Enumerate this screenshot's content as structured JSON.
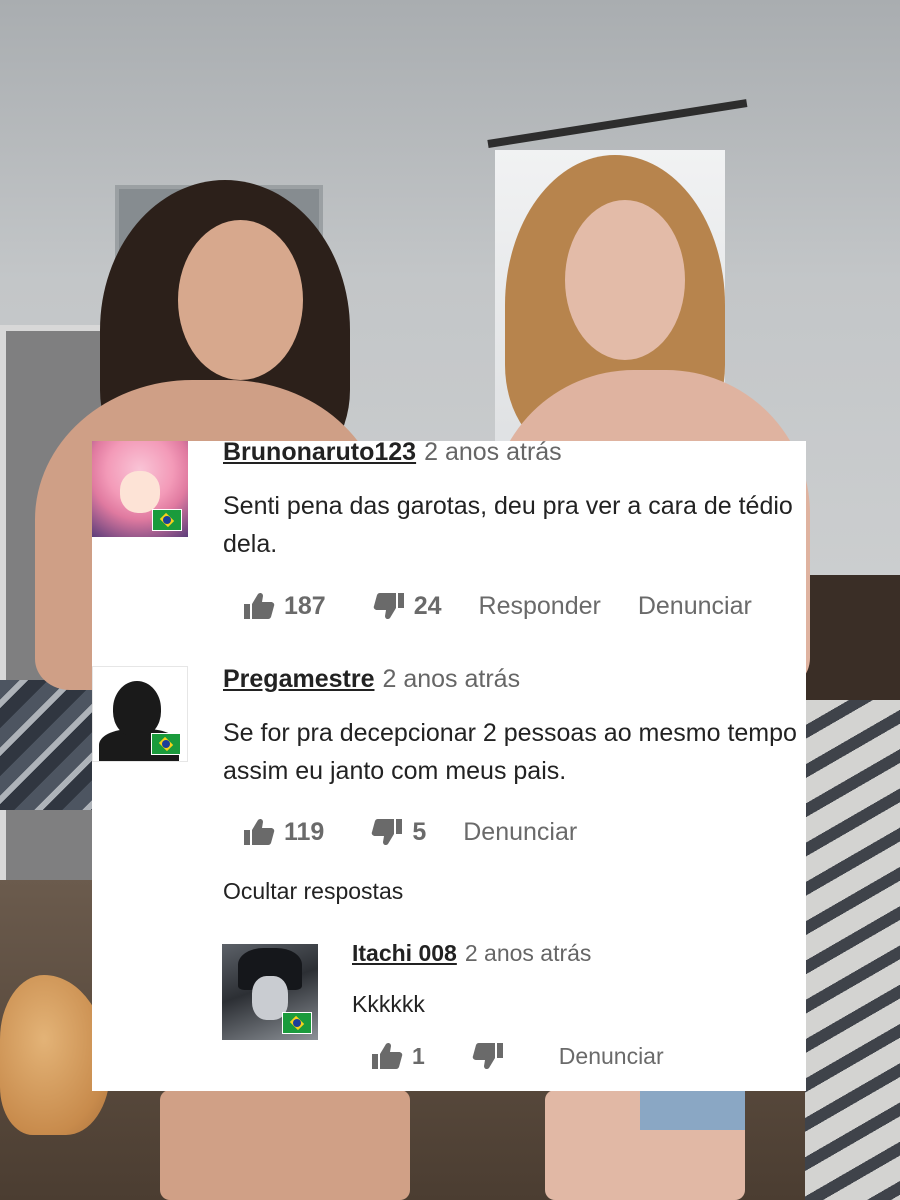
{
  "comments": [
    {
      "username": "Brunonaruto123",
      "time": "2 anos atrás",
      "text": "Senti pena das garotas, deu pra ver a cara de tédio dela.",
      "likes": "187",
      "dislikes": "24",
      "reply_label": "Responder",
      "report_label": "Denunciar",
      "avatar_icon": "anime-girl-avatar",
      "flag": "brazil-flag"
    },
    {
      "username": "Pregamestre",
      "time": "2 anos atrás",
      "text": "Se for pra decepcionar 2 pessoas ao mesmo tempo assim eu janto com meus pais.",
      "likes": "119",
      "dislikes": "5",
      "report_label": "Denunciar",
      "avatar_icon": "default-silhouette-avatar",
      "flag": "brazil-flag"
    }
  ],
  "hide_replies_label": "Ocultar respostas",
  "reply": {
    "username": "Itachi 008",
    "time": "2 anos atrás",
    "text": "Kkkkkk",
    "likes": "1",
    "report_label": "Denunciar",
    "avatar_icon": "itachi-avatar",
    "flag": "brazil-flag"
  },
  "colors": {
    "panel_bg": "#ffffff",
    "text": "#222222",
    "muted": "#666666",
    "icon": "#6a6a6a",
    "flag_green": "#1a9b3c",
    "flag_yellow": "#f6d21a",
    "flag_blue": "#1c3f9a"
  }
}
